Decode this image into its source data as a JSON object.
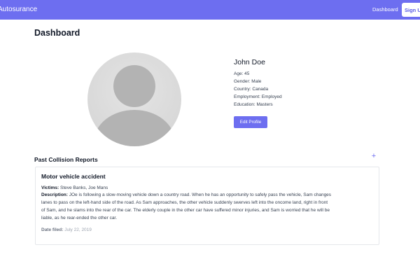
{
  "navbar": {
    "brand": "Autosurance",
    "dashboard_link": "Dashboard",
    "signup_label": "Sign Up"
  },
  "page": {
    "title": "Dashboard"
  },
  "profile": {
    "name": "John Doe",
    "age": "Age: 45",
    "gender": "Gender: Male",
    "country": "Country: Canada",
    "employment": "Employment: Employed",
    "education": "Education: Masters",
    "edit_label": "Edit Profile"
  },
  "reports_section": {
    "title": "Past Collision Reports",
    "add_icon": "+"
  },
  "report": {
    "title": "Motor vehicle accident",
    "victims_label": "Victims:",
    "victims_value": "Steve Banks, Joe Mans",
    "description_label": "Description:",
    "description_lines": [
      "JOe is following a slow-moving vehicle down a country road. When he has an opportunity to safely pass the vehicle, Sam changes",
      "lanes to pass on the left-hand side of the road. As Sam approaches, the other vehicle suddenly swerves left into the oncome land, right in front",
      "of Sam, and he slams into the rear of the car. The elderly couple in the other car have suffered minor injuries, and Sam is worried that he will be",
      "liable, as he rear-ended the other car."
    ],
    "date_label": "Date filed:",
    "date_value": "July 22, 2019"
  },
  "colors": {
    "navbar": "#6d6ef0",
    "accent": "#6d6ef0",
    "avatar_bg": "#dcdcdc",
    "avatar_figure": "#b3b3b3"
  }
}
